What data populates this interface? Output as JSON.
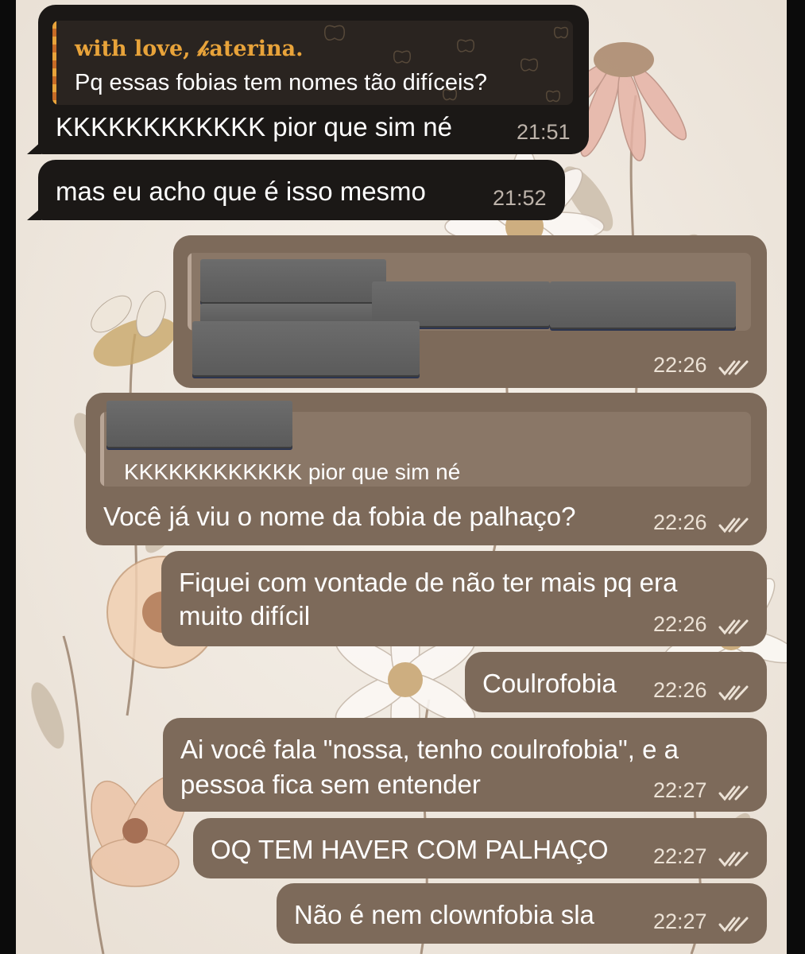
{
  "colors": {
    "incoming_bubble": "#1b1816",
    "outgoing_bubble": "#7d6a5a",
    "quote_accent_incoming": "#e8a33a",
    "quote_accent_outgoing": "#b8a596",
    "wallpaper": "#f1ebe4"
  },
  "messages": [
    {
      "id": "m1",
      "direction": "incoming",
      "reply_to": {
        "author": "with love, 𝓀aterina.",
        "text": "Pq essas fobias tem nomes tão difíceis?"
      },
      "text": "KKKKKKKKKKKK pior que sim né",
      "time": "21:51"
    },
    {
      "id": "m2",
      "direction": "incoming",
      "text": "mas eu acho que é isso mesmo",
      "time": "21:52"
    },
    {
      "id": "m3",
      "direction": "outgoing",
      "content": "redacted",
      "time": "22:26",
      "status_icon": "double-check-icon"
    },
    {
      "id": "m4",
      "direction": "outgoing",
      "reply_to": {
        "author": "",
        "text": "KKKKKKKKKKKK pior que sim né"
      },
      "text": "Você já viu o nome da fobia de palhaço?",
      "time": "22:26",
      "status_icon": "double-check-icon"
    },
    {
      "id": "m5",
      "direction": "outgoing",
      "lines": [
        "Fiquei com vontade de não ter mais pq era",
        "muito difícil"
      ],
      "time": "22:26",
      "status_icon": "double-check-icon"
    },
    {
      "id": "m6",
      "direction": "outgoing",
      "text": "Coulrofobia",
      "time": "22:26",
      "status_icon": "double-check-icon"
    },
    {
      "id": "m7",
      "direction": "outgoing",
      "lines": [
        "Ai você fala \"nossa, tenho coulrofobia\", e a",
        "pessoa fica sem entender"
      ],
      "time": "22:27",
      "status_icon": "double-check-icon"
    },
    {
      "id": "m8",
      "direction": "outgoing",
      "text": "OQ TEM HAVER COM PALHAÇO",
      "time": "22:27",
      "status_icon": "double-check-icon"
    },
    {
      "id": "m9",
      "direction": "outgoing",
      "text": "Não é nem clownfobia sla",
      "time": "22:27",
      "status_icon": "double-check-icon"
    }
  ]
}
